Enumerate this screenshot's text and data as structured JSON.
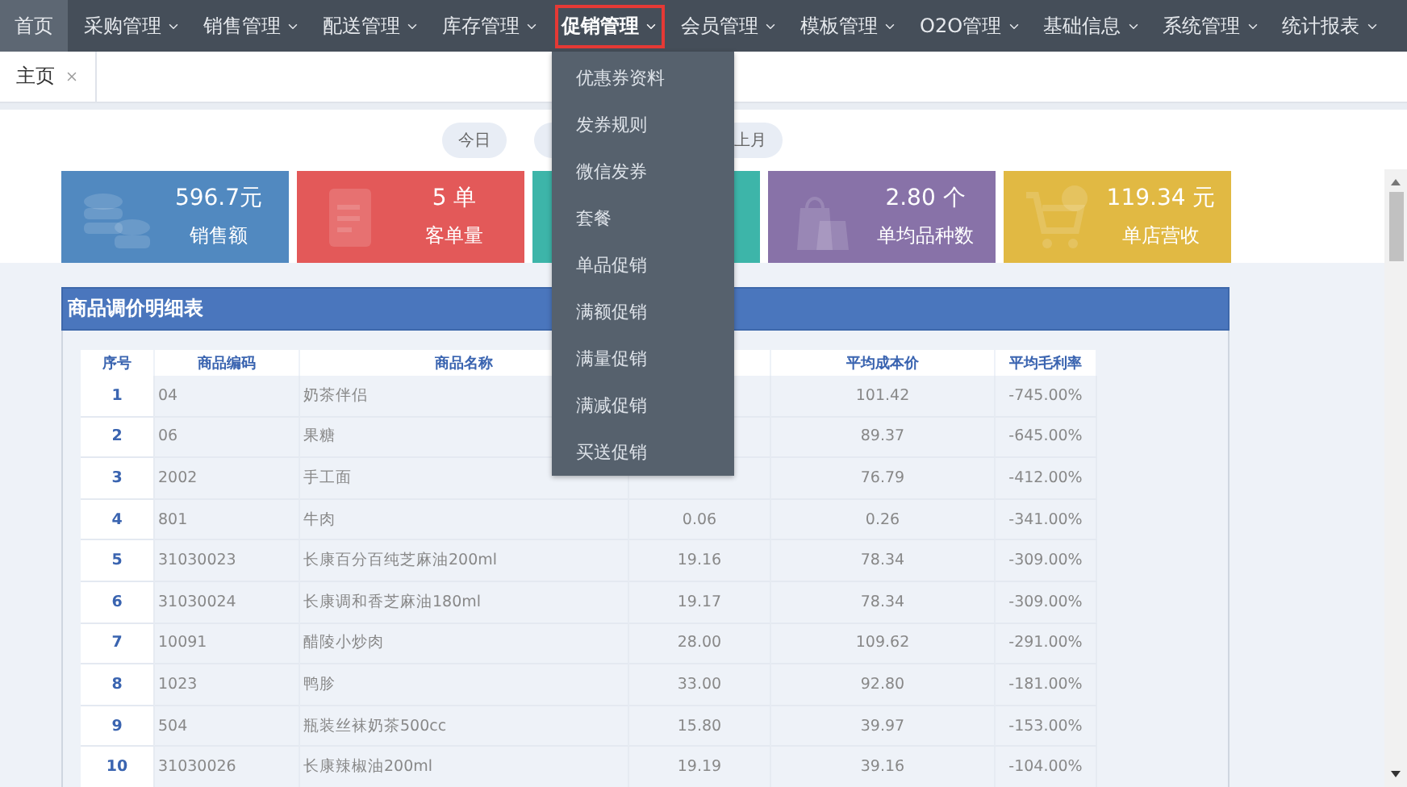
{
  "nav": {
    "items": [
      {
        "label": "首页",
        "selected": true,
        "open": false,
        "has_menu": false
      },
      {
        "label": "采购管理",
        "selected": false,
        "open": false,
        "has_menu": true
      },
      {
        "label": "销售管理",
        "selected": false,
        "open": false,
        "has_menu": true
      },
      {
        "label": "配送管理",
        "selected": false,
        "open": false,
        "has_menu": true
      },
      {
        "label": "库存管理",
        "selected": false,
        "open": false,
        "has_menu": true
      },
      {
        "label": "促销管理",
        "selected": false,
        "open": true,
        "has_menu": true
      },
      {
        "label": "会员管理",
        "selected": false,
        "open": false,
        "has_menu": true
      },
      {
        "label": "模板管理",
        "selected": false,
        "open": false,
        "has_menu": true
      },
      {
        "label": "O2O管理",
        "selected": false,
        "open": false,
        "has_menu": true
      },
      {
        "label": "基础信息",
        "selected": false,
        "open": false,
        "has_menu": true
      },
      {
        "label": "系统管理",
        "selected": false,
        "open": false,
        "has_menu": true
      },
      {
        "label": "统计报表",
        "selected": false,
        "open": false,
        "has_menu": true
      }
    ]
  },
  "dropdown": {
    "items": [
      "优惠券资料",
      "发券规则",
      "微信发券",
      "套餐",
      "单品促销",
      "满额促销",
      "满量促销",
      "满减促销",
      "买送促销"
    ]
  },
  "tabs": [
    {
      "label": "主页",
      "selected": true,
      "closable": true
    }
  ],
  "date_buttons": [
    {
      "kind": "pill",
      "label": "今日"
    },
    {
      "kind": "covered"
    },
    {
      "kind": "pill",
      "label": "上月"
    }
  ],
  "cards": [
    {
      "value": "596.7元",
      "label": "销售额",
      "color": "#5189c0"
    },
    {
      "value": "5 单",
      "label": "客单量",
      "color": "#e35959"
    },
    {
      "color": "#3db5a9"
    },
    {
      "value": "2.80 个",
      "label": "单均品种数",
      "color": "#8872a8"
    },
    {
      "value": "119.34 元",
      "label": "单店营收",
      "color": "#e1b943"
    }
  ],
  "table": {
    "title": "商品调价明细表",
    "columns": [
      {
        "label": "序号"
      },
      {
        "label": "商品编码"
      },
      {
        "label": "商品名称"
      },
      {},
      {
        "label": "平均成本价"
      },
      {
        "label": "平均毛利率"
      }
    ],
    "rows": [
      [
        "1",
        "04",
        "奶茶伴侣",
        null,
        "101.42",
        "-745.00%"
      ],
      [
        "2",
        "06",
        "果糖",
        null,
        "89.37",
        "-645.00%"
      ],
      [
        "3",
        "2002",
        "手工面",
        null,
        "76.79",
        "-412.00%"
      ],
      [
        "4",
        "801",
        "牛肉",
        "0.06",
        "0.26",
        "-341.00%"
      ],
      [
        "5",
        "31030023",
        "长康百分百纯芝麻油200ml",
        "19.16",
        "78.34",
        "-309.00%"
      ],
      [
        "6",
        "31030024",
        "长康调和香芝麻油180ml",
        "19.17",
        "78.34",
        "-309.00%"
      ],
      [
        "7",
        "10091",
        "醋陵小炒肉",
        "28.00",
        "109.62",
        "-291.00%"
      ],
      [
        "8",
        "1023",
        "鸭胗",
        "33.00",
        "92.80",
        "-181.00%"
      ],
      [
        "9",
        "504",
        "瓶装丝袜奶茶500cc",
        "15.80",
        "39.97",
        "-153.00%"
      ],
      [
        "10",
        "31030026",
        "长康辣椒油200ml",
        "19.19",
        "39.16",
        "-104.00%"
      ]
    ]
  }
}
